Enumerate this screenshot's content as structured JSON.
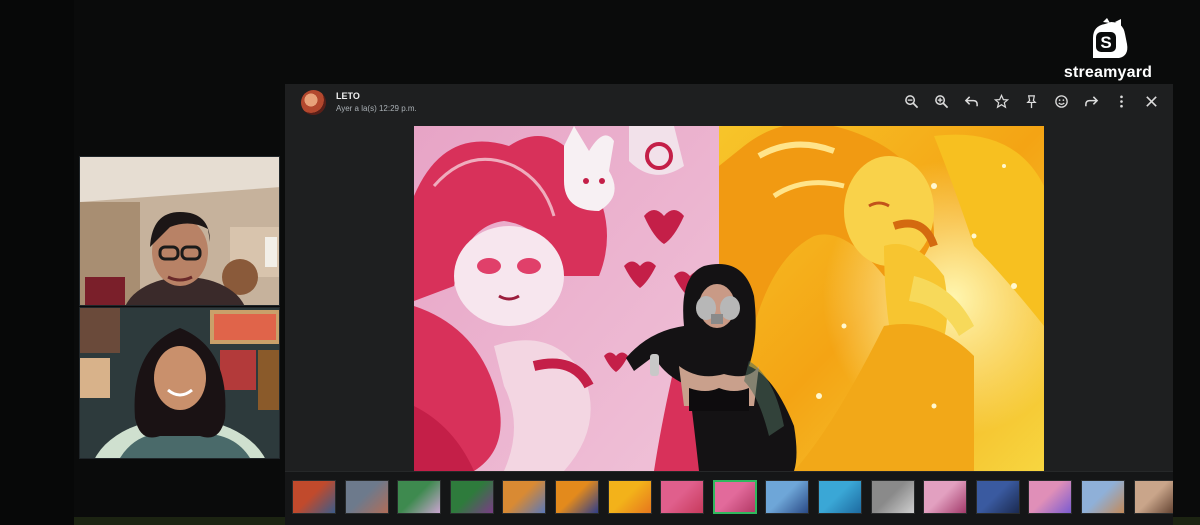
{
  "brand": {
    "name": "streamyard",
    "logo_letter": "S"
  },
  "post": {
    "author": "LETO",
    "timestamp": "Ayer a la(s) 12:29 p.m."
  },
  "toolbar": [
    {
      "icon": "zoom-out-icon"
    },
    {
      "icon": "zoom-in-icon"
    },
    {
      "icon": "reply-icon"
    },
    {
      "icon": "star-icon"
    },
    {
      "icon": "pin-icon"
    },
    {
      "icon": "emoji-icon"
    },
    {
      "icon": "forward-icon"
    },
    {
      "icon": "more-options-icon"
    },
    {
      "icon": "close-icon"
    }
  ],
  "thumbnails": {
    "active_index": 8,
    "colors": [
      [
        "#c14a2c",
        "#3b5c8a"
      ],
      [
        "#6d7a8c",
        "#b06d58"
      ],
      [
        "#3e8a4f",
        "#c9a4cf"
      ],
      [
        "#2e7b3c",
        "#7a3c86"
      ],
      [
        "#d98a33",
        "#5a78b8"
      ],
      [
        "#e38a1c",
        "#2f3e8a"
      ],
      [
        "#f3b21a",
        "#e6761d"
      ],
      [
        "#e05f8c",
        "#c73a5c"
      ],
      [
        "#e26a9b",
        "#b33a66"
      ],
      [
        "#6ea6d8",
        "#2a4a86"
      ],
      [
        "#3aa7d6",
        "#1d6aa0"
      ],
      [
        "#8a8a8a",
        "#cfcfcf"
      ],
      [
        "#e2a0c0",
        "#a23a6a"
      ],
      [
        "#3a5aa0",
        "#1b2a50"
      ],
      [
        "#e08fb8",
        "#7a5bd0"
      ],
      [
        "#8fb0d8",
        "#c28a5a"
      ],
      [
        "#c9a58a",
        "#5a3a2a"
      ]
    ]
  }
}
